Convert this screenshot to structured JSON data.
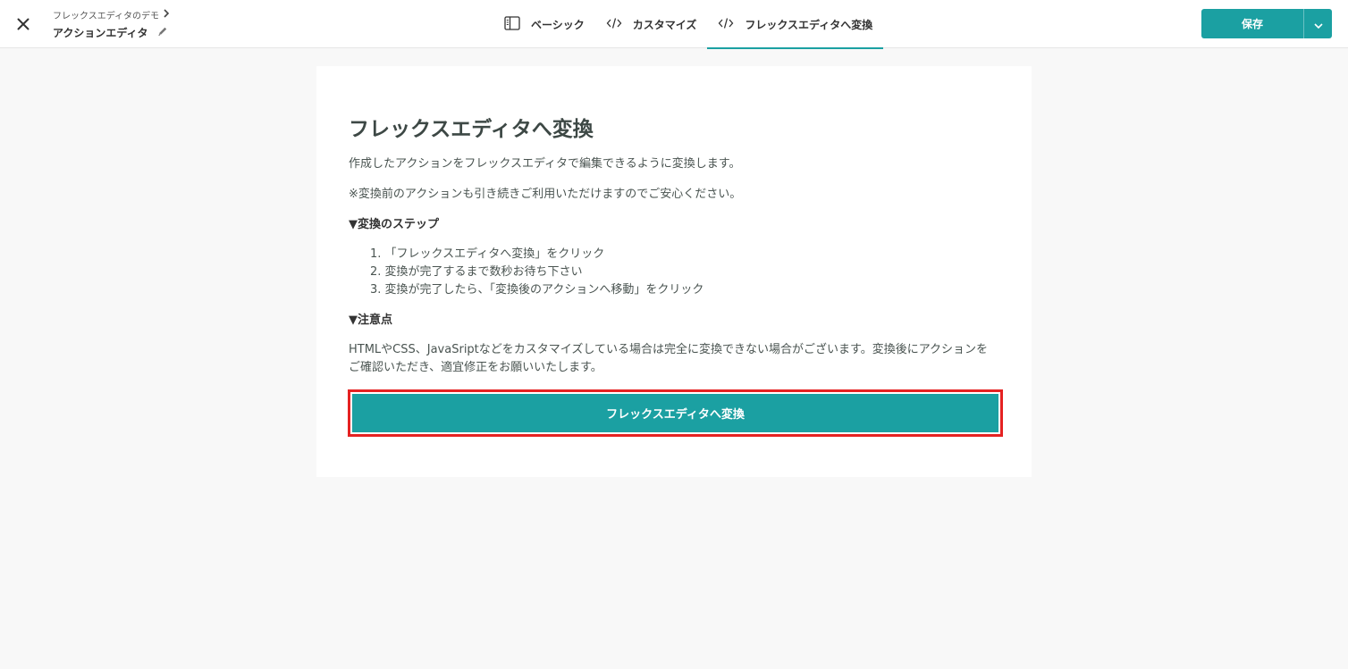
{
  "header": {
    "breadcrumb_parent": "フレックスエディタのデモ",
    "breadcrumb_current": "アクションエディタ",
    "tabs": [
      {
        "label": "ベーシック",
        "icon": "sidebar-layout-icon"
      },
      {
        "label": "カスタマイズ",
        "icon": "code-icon"
      },
      {
        "label": "フレックスエディタへ変換",
        "icon": "code-icon",
        "active": true
      }
    ],
    "save_label": "保存"
  },
  "content": {
    "title": "フレックスエディタへ変換",
    "intro": "作成したアクションをフレックスエディタで編集できるように変換します。",
    "reassurance": "※変換前のアクションも引き続きご利用いただけますのでご安心ください。",
    "steps_heading": "▼変換のステップ",
    "steps": [
      "1. 「フレックスエディタへ変換」をクリック",
      "2. 変換が完了するまで数秒お待ち下さい",
      "3. 変換が完了したら、「変換後のアクションへ移動」をクリック"
    ],
    "notes_heading": "▼注意点",
    "notes_text": "HTMLやCSS、JavaSriptなどをカスタマイズしている場合は完全に変換できない場合がございます。変換後にアクションをご確認いただき、適宜修正をお願いいたします。",
    "convert_button": "フレックスエディタへ変換"
  },
  "colors": {
    "accent": "#1ba0a2",
    "highlight_border": "#e52222"
  }
}
